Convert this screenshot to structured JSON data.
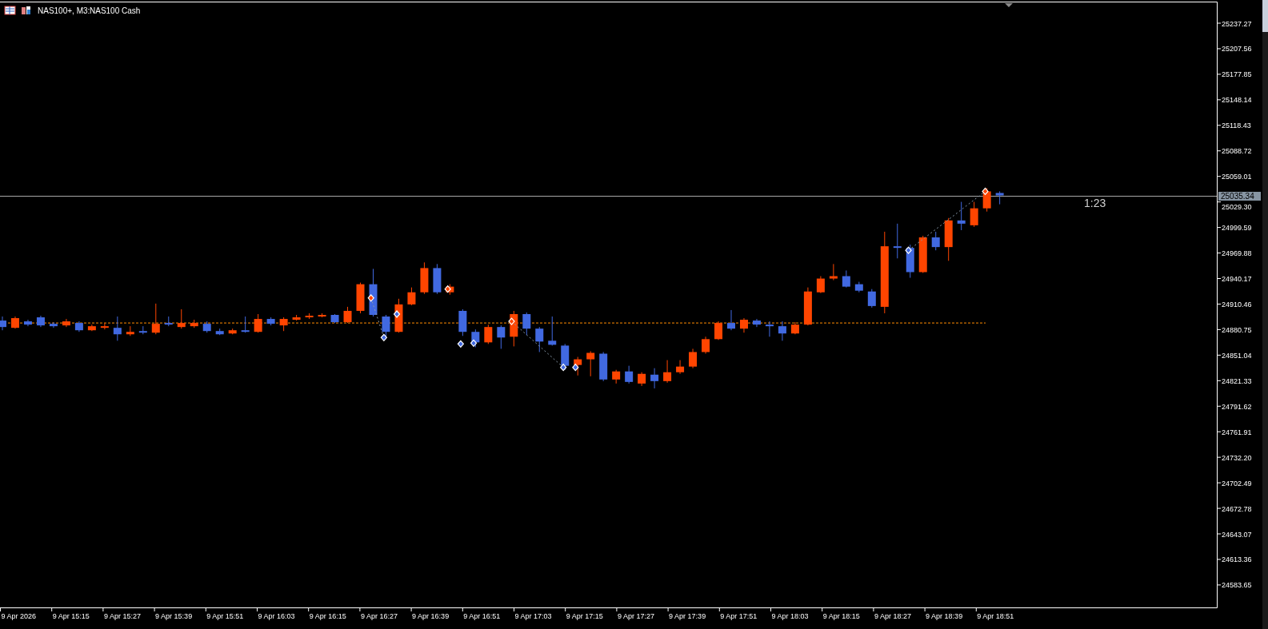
{
  "chart": {
    "symbol": "NAS100+, M3:",
    "description": "NAS100 Cash",
    "countdown": "1:23",
    "current_price": "25035.34"
  },
  "price_axis": [
    "25237.27",
    "25207.56",
    "25177.85",
    "25148.14",
    "25118.43",
    "25088.72",
    "25059.01",
    "25029.30",
    "24999.59",
    "24969.88",
    "24940.17",
    "24910.46",
    "24880.75",
    "24851.04",
    "24821.33",
    "24791.62",
    "24761.91",
    "24732.20",
    "24702.49",
    "24672.78",
    "24643.07",
    "24613.36",
    "24583.65"
  ],
  "time_axis": [
    "9 Apr 2026",
    "9 Apr 15:15",
    "9 Apr 15:27",
    "9 Apr 15:39",
    "9 Apr 15:51",
    "9 Apr 16:03",
    "9 Apr 16:15",
    "9 Apr 16:27",
    "9 Apr 16:39",
    "9 Apr 16:51",
    "9 Apr 17:03",
    "9 Apr 17:15",
    "9 Apr 17:27",
    "9 Apr 17:39",
    "9 Apr 17:51",
    "9 Apr 18:03",
    "9 Apr 18:15",
    "9 Apr 18:27",
    "9 Apr 18:39",
    "9 Apr 18:51"
  ]
}
